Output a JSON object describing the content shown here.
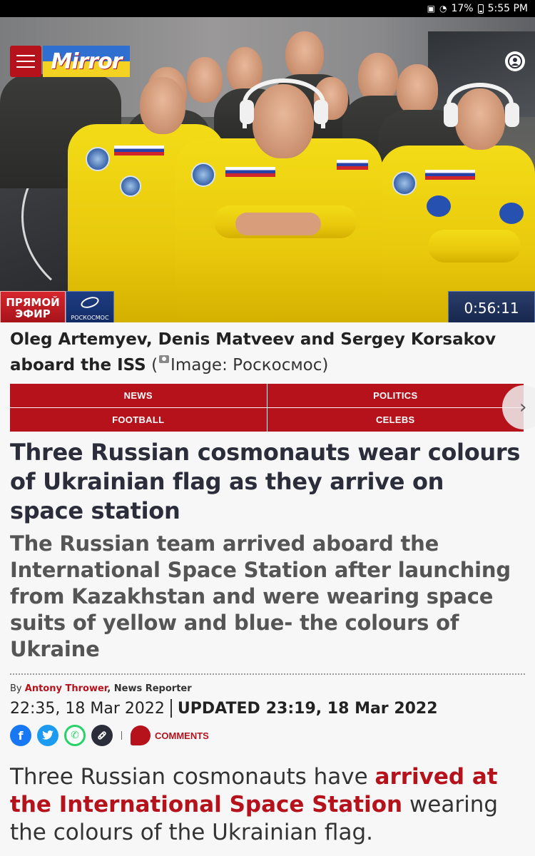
{
  "status_bar": {
    "battery": "17%",
    "time": "5:55 PM"
  },
  "header": {
    "logo_text": "Mirror"
  },
  "hero": {
    "live_line1": "ПРЯМОЙ",
    "live_line2": "ЭФИР",
    "channel": "РОСКОСМОС",
    "timer": "0:56:11"
  },
  "caption": {
    "text": "Oleg Artemyev, Denis Matveev and Sergey Korsakov aboard the ISS",
    "credit_open": "(",
    "credit": "Image: Роскосмос)"
  },
  "nav": {
    "items": [
      "NEWS",
      "POLITICS",
      "FOOTBALL",
      "CELEBS"
    ]
  },
  "article": {
    "headline": "Three Russian cosmonauts wear colours of Ukrainian flag as they arrive on space station",
    "standfirst": "The Russian team arrived aboard the International Space Station after launching from Kazakhstan and were wearing space suits of yellow and blue- the colours of Ukraine",
    "by": "By",
    "author": "Antony Thrower",
    "role": ", News Reporter",
    "published": "22:35, 18 Mar 2022",
    "updated_label": "UPDATED",
    "updated": "23:19, 18 Mar 2022",
    "comments_label": "COMMENTS",
    "body_intro": "Three Russian cosmonauts have ",
    "body_link": "arrived at the International Space Station",
    "body_rest": " wearing the colours of the Ukrainian flag."
  },
  "share": {
    "facebook_glyph": "f",
    "whatsapp_glyph": "✆"
  },
  "colors": {
    "brand_red": "#b5121b",
    "headline": "#2b2d3a"
  }
}
